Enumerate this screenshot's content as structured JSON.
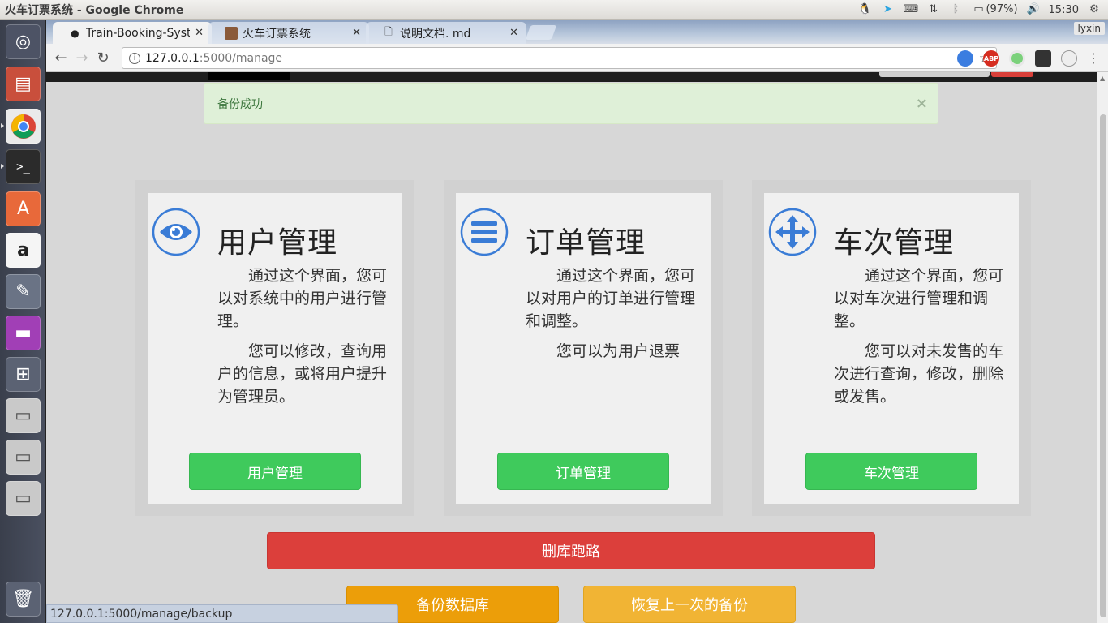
{
  "window": {
    "title": "火车订票系统 - Google Chrome"
  },
  "tray": {
    "battery": "(97%)",
    "time": "15:30"
  },
  "tabs": [
    {
      "label": "Train-Booking-Syste",
      "active": true
    },
    {
      "label": "火车订票系统",
      "active": false
    },
    {
      "label": "说明文档. md",
      "active": false
    }
  ],
  "profile": "lyxin",
  "address": {
    "host": "127.0.0.1",
    "path": ":5000/manage"
  },
  "extensions": {
    "abp": "ABP"
  },
  "alert": {
    "message": "备份成功",
    "close": "×"
  },
  "cards": [
    {
      "icon": "eye-icon",
      "title": "用户管理",
      "paragraphs": [
        "通过这个界面，您可以对系统中的用户进行管理。",
        "您可以修改，查询用户的信息，或将用户提升为管理员。"
      ],
      "button": "用户管理"
    },
    {
      "icon": "list-icon",
      "title": "订单管理",
      "paragraphs": [
        "通过这个界面，您可以对用户的订单进行管理和调整。",
        "您可以为用户退票"
      ],
      "button": "订单管理"
    },
    {
      "icon": "move-arrows-icon",
      "title": "车次管理",
      "paragraphs": [
        "通过这个界面，您可以对车次进行管理和调整。",
        "您可以对未发售的车次进行查询，修改，删除或发售。"
      ],
      "button": "车次管理"
    }
  ],
  "actions": {
    "danger": "删库跑路",
    "backup": "备份数据库",
    "restore": "恢复上一次的备份"
  },
  "status_url": "127.0.0.1:5000/manage/backup",
  "colors": {
    "success_green": "#3fca5c",
    "danger_red": "#dc3f3b",
    "backup_orange": "#ec9e09",
    "restore_amber": "#f1b434",
    "icon_blue": "#3a7cd6"
  }
}
